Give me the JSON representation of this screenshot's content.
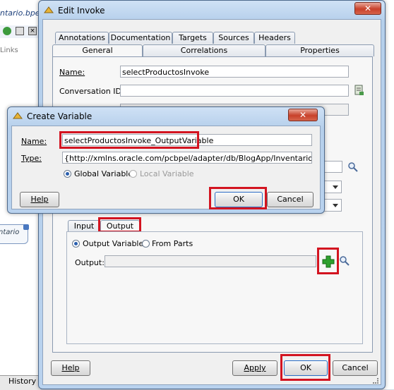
{
  "background": {
    "tab_title": "ntario.bpel",
    "links_label": "Links",
    "node_label": "ntario",
    "history_tab": "History"
  },
  "edit_invoke": {
    "title": "Edit Invoke",
    "tabs_row1": [
      "Annotations",
      "Documentation",
      "Targets",
      "Sources",
      "Headers"
    ],
    "tabs_row2": [
      "General",
      "Correlations",
      "Properties"
    ],
    "name_label": "Name:",
    "name_value": "selectProductosInvoke",
    "conversation_label": "Conversation ID:",
    "conversation_value": "",
    "io_tabs": [
      "Input",
      "Output"
    ],
    "output_variable_label": "Output Variable",
    "from_parts_label": "From Parts",
    "output_label": "Output:",
    "output_value": "",
    "help_label": "Help",
    "apply_label": "Apply",
    "ok_label": "OK",
    "cancel_label": "Cancel"
  },
  "create_variable": {
    "title": "Create Variable",
    "name_label": "Name:",
    "name_value": "selectProductosInvoke_OutputVariable",
    "type_label": "Type:",
    "type_value": "{http://xmlns.oracle.com/pcbpel/adapter/db/BlogApp/InventarioProject/}",
    "global_label": "Global Variable",
    "local_label": "Local Variable",
    "help_label": "Help",
    "ok_label": "OK",
    "cancel_label": "Cancel"
  },
  "colors": {
    "highlight": "#d31420",
    "add_icon": "#2ea02e"
  }
}
